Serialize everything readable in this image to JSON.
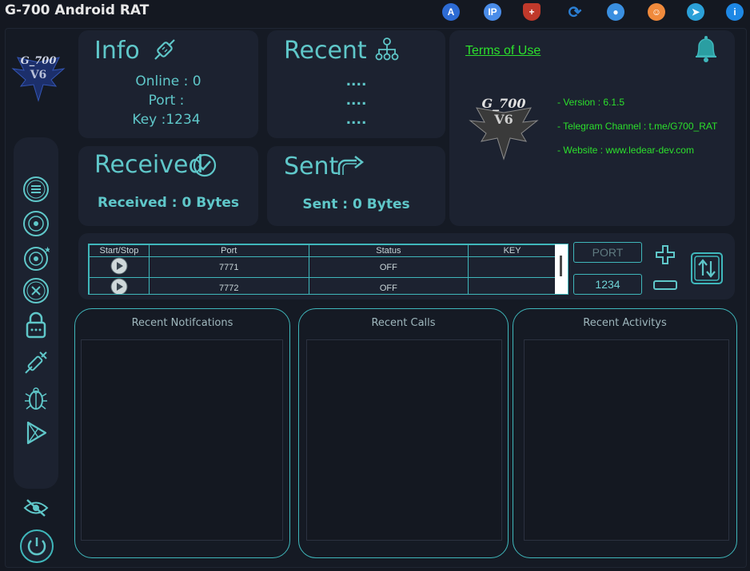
{
  "app": {
    "title": "G-700 Android RAT"
  },
  "toolbar": {
    "icons": [
      {
        "name": "translate-icon",
        "glyph": "A",
        "color": "#2d6bd4"
      },
      {
        "name": "ip-location-icon",
        "glyph": "IP",
        "color": "#4a8ce8"
      },
      {
        "name": "shield-icon",
        "glyph": "+",
        "color": "#c0392b"
      },
      {
        "name": "sync-icon",
        "glyph": "⟳",
        "color": "#2b7fd4"
      },
      {
        "name": "cursor-globe-icon",
        "glyph": "●",
        "color": "#3a8fe0"
      },
      {
        "name": "user-avatar-icon",
        "glyph": "☺",
        "color": "#f08a3c"
      },
      {
        "name": "telegram-icon",
        "glyph": "➤",
        "color": "#2ba0d8"
      },
      {
        "name": "info-icon",
        "glyph": "i",
        "color": "#1e88e5"
      }
    ]
  },
  "info": {
    "title": "Info",
    "online": "Online : 0",
    "port": "Port :",
    "key": "Key :1234"
  },
  "recent": {
    "title": "Recent",
    "lines": [
      "....",
      "....",
      "...."
    ]
  },
  "received": {
    "title": "Received",
    "text": "Received : 0 Bytes"
  },
  "sent": {
    "title": "Sent",
    "text": "Sent : 0 Bytes"
  },
  "about": {
    "terms": "Terms of Use",
    "version": "-  Version :  6.1.5",
    "telegram": "-  Telegram Channel : t.me/G700_RAT",
    "website": "- Website : www.ledear-dev.com",
    "logo_text": "G_700"
  },
  "ports_table": {
    "headers": [
      "Start/Stop",
      "Port",
      "Status",
      "KEY"
    ],
    "rows": [
      {
        "port": "7771",
        "status": "OFF",
        "key": ""
      },
      {
        "port": "7772",
        "status": "OFF",
        "key": ""
      }
    ]
  },
  "port_input": {
    "placeholder": "PORT"
  },
  "key_input": {
    "value": "1234"
  },
  "panels": {
    "notifications": "Recent Notifcations",
    "calls": "Recent Calls",
    "activities": "Recent Activitys"
  },
  "colors": {
    "accent": "#5fc7c9",
    "border": "#3fb7bb",
    "green": "#2ce02c",
    "card": "#1c2230",
    "background": "#141821"
  }
}
